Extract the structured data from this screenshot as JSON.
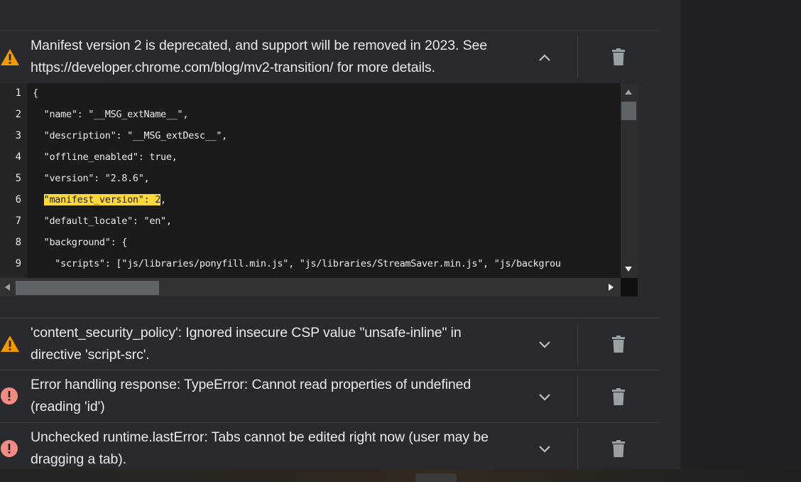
{
  "errors": [
    {
      "severity": "warning",
      "message_line1": "Manifest version 2 is deprecated, and support will be removed in 2023. See",
      "message_line2": "https://developer.chrome.com/blog/mv2-transition/ for more details.",
      "expanded": true
    },
    {
      "severity": "warning",
      "message_line1": "'content_security_policy': Ignored insecure CSP value \"unsafe-inline\" in",
      "message_line2": "directive 'script-src'.",
      "expanded": false
    },
    {
      "severity": "error",
      "message_line1": "Error handling response: TypeError: Cannot read properties of undefined",
      "message_line2": "(reading 'id')",
      "expanded": false
    },
    {
      "severity": "error",
      "message_line1": "Unchecked runtime.lastError: Tabs cannot be edited right now (user may be",
      "message_line2": "dragging a tab).",
      "expanded": false
    }
  ],
  "code": {
    "lines": [
      {
        "num": "1",
        "text": "{"
      },
      {
        "num": "2",
        "text": "  \"name\": \"__MSG_extName__\","
      },
      {
        "num": "3",
        "text": "  \"description\": \"__MSG_extDesc__\","
      },
      {
        "num": "4",
        "text": "  \"offline_enabled\": true,"
      },
      {
        "num": "5",
        "text": "  \"version\": \"2.8.6\","
      },
      {
        "num": "6",
        "pre": "  ",
        "highlight": "\"manifest_version\": 2",
        "post": ","
      },
      {
        "num": "7",
        "text": "  \"default_locale\": \"en\","
      },
      {
        "num": "8",
        "text": "  \"background\": {"
      },
      {
        "num": "9",
        "text": "    \"scripts\": [\"js/libraries/ponyfill.min.js\", \"js/libraries/StreamSaver.min.js\", \"js/backgrou"
      }
    ],
    "highlight_color": "#ffd83a"
  },
  "colors": {
    "warning": "#f29900",
    "error": "#f28b82",
    "background": "#292a2d",
    "code_background": "#1b1b1b"
  },
  "icons": {
    "warning": "warning-triangle-icon",
    "error": "error-circle-icon",
    "expand": "chevron-down-icon",
    "collapse": "chevron-up-icon",
    "delete": "trash-icon"
  }
}
